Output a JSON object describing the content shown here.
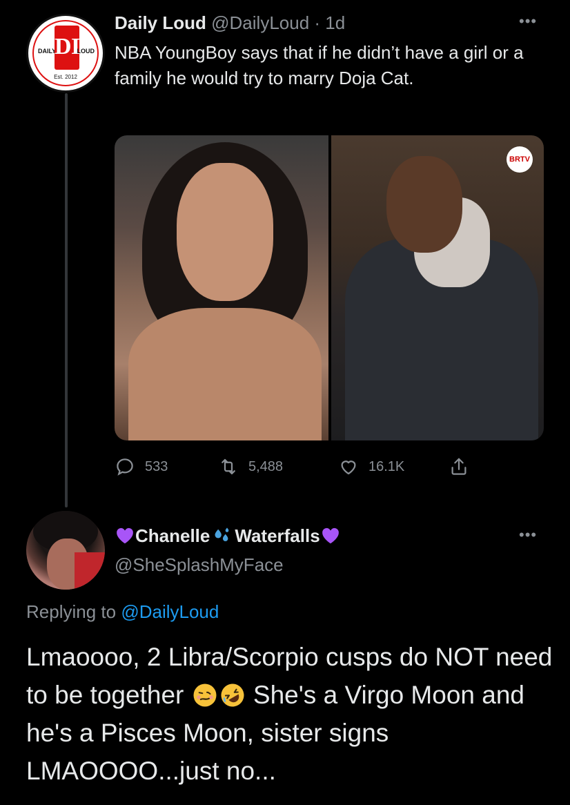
{
  "tweet": {
    "author_name": "Daily Loud",
    "author_handle": "@DailyLoud",
    "separator": " · ",
    "time": "1d",
    "text": "NBA YoungBoy says that if he didn’t have a girl or a family he would try to marry Doja Cat.",
    "avatar": {
      "left_word": "DAILY",
      "monogram": "DL",
      "right_word": "LOUD",
      "established": "Est. 2012"
    },
    "media_badge": "BRTV",
    "counts": {
      "replies": "533",
      "retweets": "5,488",
      "likes": "16.1K"
    }
  },
  "reply": {
    "name_part1": "Chanelle",
    "name_part2": "Waterfalls",
    "handle": "@SheSplashMyFace",
    "replying_label": "Replying to ",
    "replying_handle": "@DailyLoud",
    "text_part1": "Lmaoooo, 2 Libra/Scorpio cusps do NOT need to be together ",
    "text_part2": " She's a Virgo Moon and he's a Pisces Moon, sister signs LMAOOOO...just no..."
  },
  "icons": {
    "more": "more-dots-icon",
    "reply": "reply-icon",
    "retweet": "retweet-icon",
    "like": "heart-icon",
    "share": "share-icon",
    "purple_heart": "purple-heart-icon",
    "sweat_drops": "sweat-droplets-icon",
    "woozy": "woozy-face-icon",
    "rofl": "rofl-face-icon"
  },
  "colors": {
    "background": "#000000",
    "text": "#e7e9ea",
    "muted": "#8b9096",
    "link": "#1d9bf0",
    "brand_red": "#dd1111",
    "purple": "#a855f7"
  }
}
